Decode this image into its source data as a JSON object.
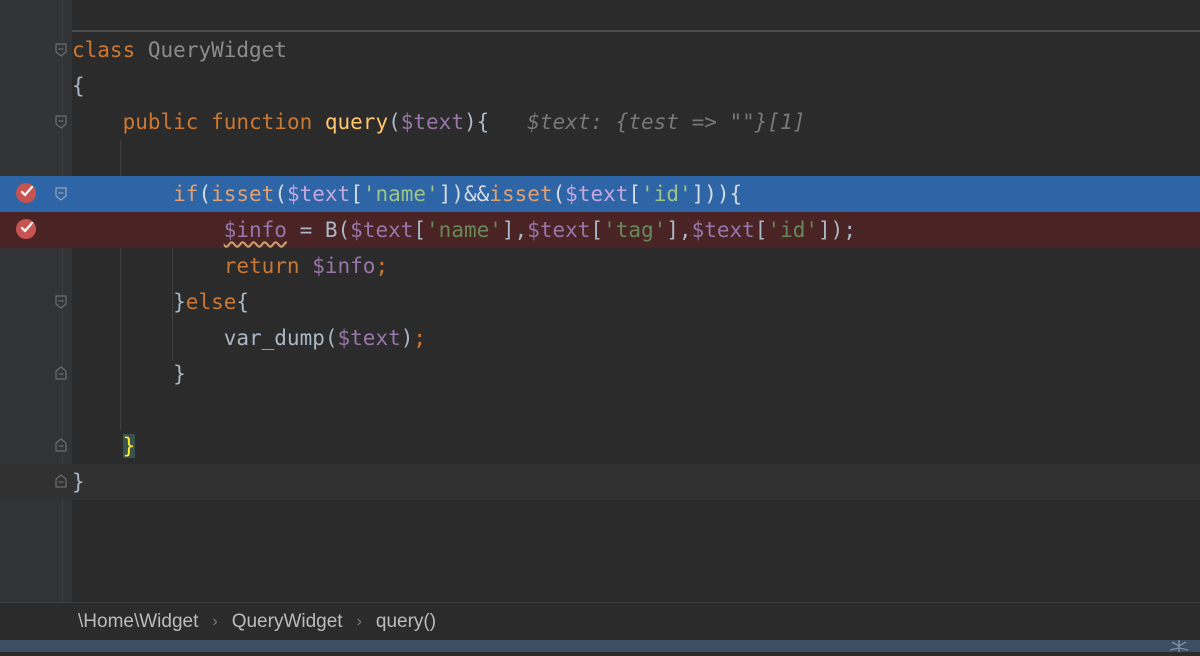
{
  "editor": {
    "lines": [
      {
        "tokens": [
          [
            "kw",
            "class"
          ],
          [
            "plain",
            " "
          ],
          [
            "hintcls",
            "QueryWidget"
          ]
        ]
      },
      {
        "tokens": [
          [
            "plain",
            "{"
          ]
        ]
      },
      {
        "tokens": [
          [
            "plain",
            "    "
          ],
          [
            "kw",
            "public function "
          ],
          [
            "fn",
            "query"
          ],
          [
            "plain",
            "("
          ],
          [
            "var",
            "$text"
          ],
          [
            "plain",
            "){"
          ],
          [
            "plain",
            "   "
          ],
          [
            "hint",
            "$text: {test => \"\"}[1]"
          ]
        ]
      },
      {
        "tokens": []
      },
      {
        "tokens": [
          [
            "plain",
            "        "
          ],
          [
            "kw",
            "if"
          ],
          [
            "plain",
            "("
          ],
          [
            "kw",
            "isset"
          ],
          [
            "plain",
            "("
          ],
          [
            "var",
            "$text"
          ],
          [
            "plain",
            "["
          ],
          [
            "str",
            "'name'"
          ],
          [
            "plain",
            "])&&"
          ],
          [
            "kw",
            "isset"
          ],
          [
            "plain",
            "("
          ],
          [
            "var",
            "$text"
          ],
          [
            "plain",
            "["
          ],
          [
            "str",
            "'id'"
          ],
          [
            "plain",
            "])){"
          ]
        ]
      },
      {
        "tokens": [
          [
            "plain",
            "            "
          ],
          [
            "varsq",
            "$info"
          ],
          [
            "plain",
            " = B("
          ],
          [
            "var",
            "$text"
          ],
          [
            "plain",
            "["
          ],
          [
            "str",
            "'name'"
          ],
          [
            "plain",
            "],"
          ],
          [
            "var",
            "$text"
          ],
          [
            "plain",
            "["
          ],
          [
            "str",
            "'tag'"
          ],
          [
            "plain",
            "],"
          ],
          [
            "var",
            "$text"
          ],
          [
            "plain",
            "["
          ],
          [
            "str",
            "'id'"
          ],
          [
            "plain",
            "]);"
          ]
        ]
      },
      {
        "tokens": [
          [
            "plain",
            "            "
          ],
          [
            "kw",
            "return "
          ],
          [
            "var",
            "$info"
          ],
          [
            "kw",
            ";"
          ]
        ]
      },
      {
        "tokens": [
          [
            "plain",
            "        }"
          ],
          [
            "kw",
            "else"
          ],
          [
            "plain",
            "{"
          ]
        ]
      },
      {
        "tokens": [
          [
            "plain",
            "            var_dump("
          ],
          [
            "var",
            "$text"
          ],
          [
            "plain",
            ")"
          ],
          [
            "kw",
            ";"
          ]
        ]
      },
      {
        "tokens": [
          [
            "plain",
            "        }"
          ]
        ]
      },
      {
        "tokens": []
      },
      {
        "tokens": [
          [
            "plain",
            "    "
          ],
          [
            "bracehl",
            "}"
          ]
        ]
      },
      {
        "tokens": [
          [
            "plain",
            "}"
          ]
        ]
      }
    ]
  },
  "breadcrumb": {
    "items": [
      "\\Home\\Widget",
      "QueryWidget",
      "query()"
    ],
    "separator": "›"
  },
  "colors": {
    "background": "#2b2b2b",
    "execution_line": "#2d65a6",
    "breakpoint_line": "#4a2424",
    "breakpoint": "#c75450",
    "keyword": "#cc7832",
    "function": "#ffc66d",
    "variable": "#9876aa",
    "string": "#6a8759"
  },
  "icons": {
    "breakpoint": "breakpoint-verified-icon",
    "fold": "fold-marker-icon"
  }
}
